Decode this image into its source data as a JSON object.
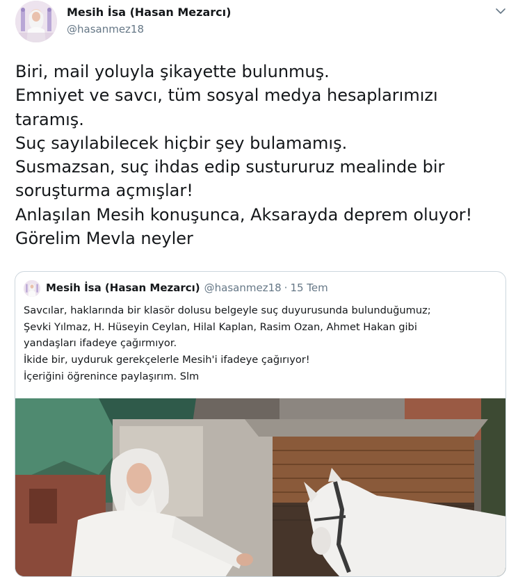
{
  "tweet": {
    "author_name": "Mesih İsa (Hasan Mezarcı)",
    "author_handle": "@hasanmez18",
    "lines": [
      "Biri, mail yoluyla şikayette bulunmuş.",
      "Emniyet ve savcı, tüm sosyal medya hesaplarımızı",
      "taramış.",
      "Suç sayılabilecek hiçbir şey bulamamış.",
      "Susmazsan, suç ihdas edip sustururuz mealinde bir",
      "soruşturma açmışlar!",
      "Anlaşılan Mesih konuşunca, Aksarayda deprem oluyor!",
      "Görelim Mevla neyler"
    ]
  },
  "quoted_tweet": {
    "author_name": "Mesih İsa (Hasan Mezarcı)",
    "author_handle": "@hasanmez18",
    "separator": "·",
    "date": "15 Tem",
    "lines": [
      "Savcılar, haklarında bir klasör dolusu belgeyle suç duyurusunda bulunduğumuz;",
      "Şevki Yılmaz, H. Hüseyin Ceylan, Hilal Kaplan, Rasim Ozan, Ahmet Hakan gibi",
      "yandaşları ifadeye çağırmıyor.",
      "İkide bir, uyduruk gerekçelerle Mesih'i ifadeye çağırıyor!",
      "İçeriğini öğrenince paylaşırım. Slm"
    ],
    "media": {
      "kind": "video-thumbnail",
      "subject": "man-with-white-horse"
    }
  },
  "icons": {
    "menu_caret": "chevron-down-icon"
  },
  "colors": {
    "text_primary": "#14171a",
    "text_secondary": "#657786",
    "border": "#ccd6dd",
    "caret": "#657786"
  }
}
